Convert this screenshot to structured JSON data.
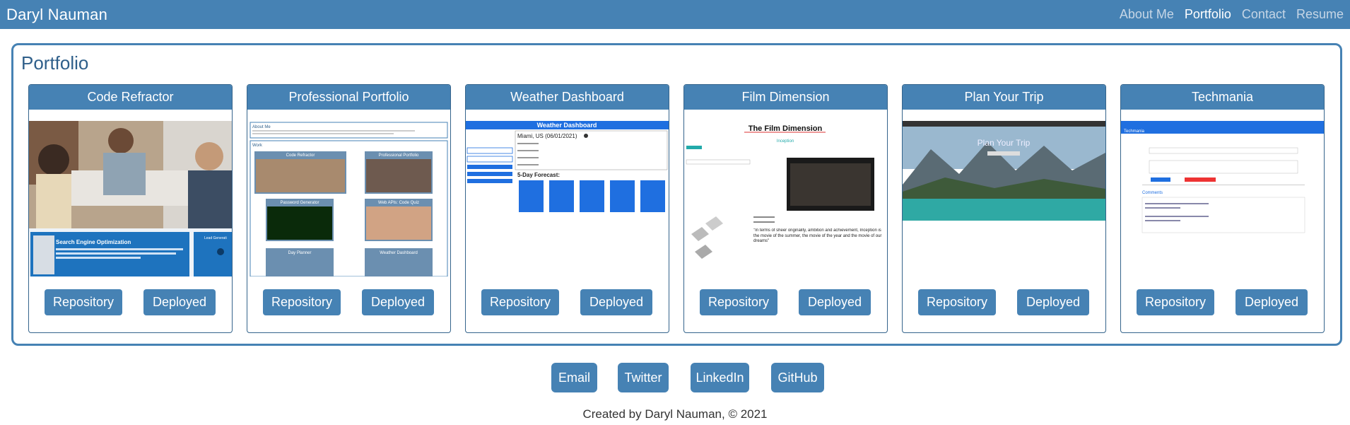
{
  "navbar": {
    "brand": "Daryl Nauman",
    "links": [
      "About Me",
      "Portfolio",
      "Contact",
      "Resume"
    ],
    "active": "Portfolio"
  },
  "portfolio": {
    "title": "Portfolio",
    "projects": [
      {
        "title": "Code Refractor",
        "repo_label": "Repository",
        "deploy_label": "Deployed",
        "shot": {
          "banner": "Search Engine Optimization",
          "side_label": "Lead Generati"
        }
      },
      {
        "title": "Professional Portfolio",
        "repo_label": "Repository",
        "deploy_label": "Deployed",
        "shot": {
          "about": "About Me",
          "work": "Work",
          "tiles": [
            "Code Refractor",
            "Professional Portfolio",
            "Password Generator",
            "Web APIs: Code Quiz",
            "Day Planner",
            "Weather Dashboard"
          ]
        }
      },
      {
        "title": "Weather Dashboard",
        "repo_label": "Repository",
        "deploy_label": "Deployed",
        "shot": {
          "header": "Weather Dashboard",
          "city": "Miami, US (06/01/2021)",
          "forecast": "5-Day Forecast:"
        }
      },
      {
        "title": "Film Dimension",
        "repo_label": "Repository",
        "deploy_label": "Deployed",
        "shot": {
          "header": "The Film Dimension",
          "movie": "Inception",
          "quote": "\"In terms of sheer originality, ambition and achievement, Inception is the movie of the summer, the movie of the year and the movie of our dreams\""
        }
      },
      {
        "title": "Plan Your Trip",
        "repo_label": "Repository",
        "deploy_label": "Deployed",
        "shot": {
          "hero": "Plan Your Trip"
        }
      },
      {
        "title": "Techmania",
        "repo_label": "Repository",
        "deploy_label": "Deployed",
        "shot": {
          "brand": "Techmania",
          "comments": "Comments"
        }
      }
    ]
  },
  "socials": [
    "Email",
    "Twitter",
    "LinkedIn",
    "GitHub"
  ],
  "footer": "Created by Daryl Nauman, © 2021",
  "colors": {
    "primary": "#4682b4",
    "border_dark": "#35648c",
    "title": "#2f5f8a"
  }
}
